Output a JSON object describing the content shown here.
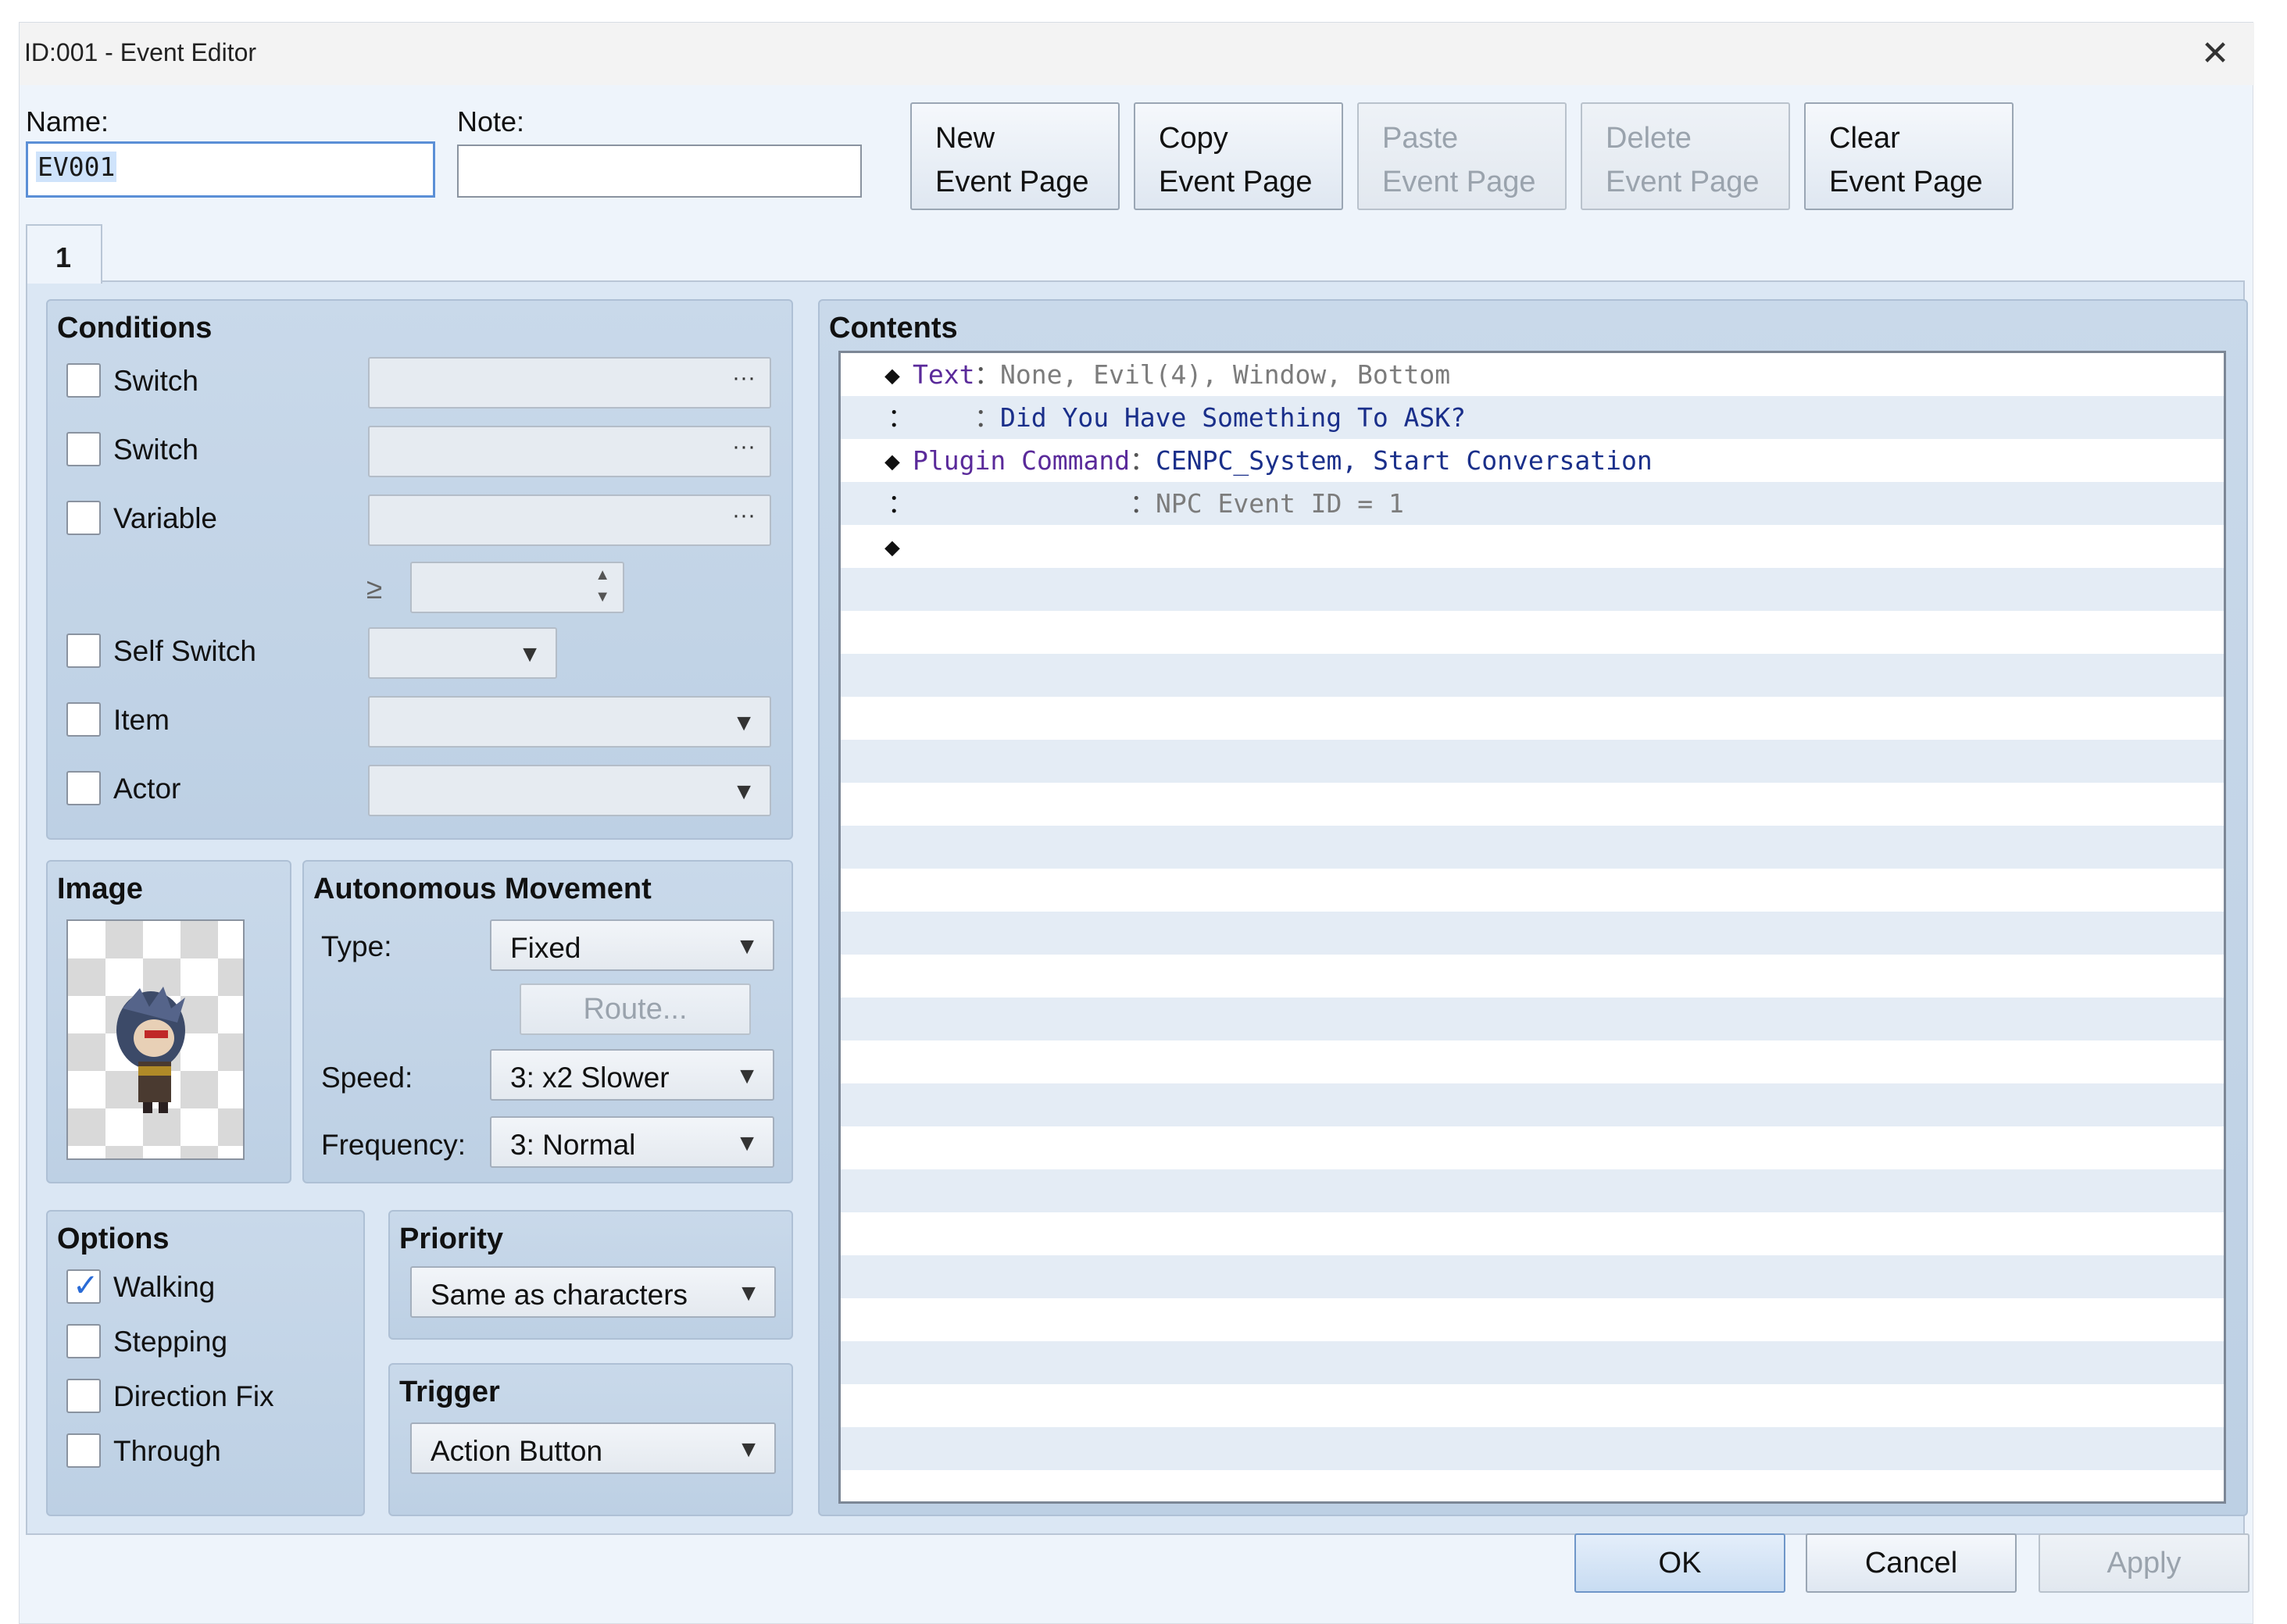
{
  "window": {
    "title": "ID:001 - Event Editor",
    "close_glyph": "✕"
  },
  "header": {
    "name_label": "Name:",
    "name_value": "EV001",
    "note_label": "Note:",
    "note_value": ""
  },
  "page_buttons": [
    {
      "line1": "New",
      "line2": "Event Page",
      "enabled": true
    },
    {
      "line1": "Copy",
      "line2": "Event Page",
      "enabled": true
    },
    {
      "line1": "Paste",
      "line2": "Event Page",
      "enabled": false
    },
    {
      "line1": "Delete",
      "line2": "Event Page",
      "enabled": false
    },
    {
      "line1": "Clear",
      "line2": "Event Page",
      "enabled": true
    }
  ],
  "tabs": [
    "1"
  ],
  "conditions": {
    "title": "Conditions",
    "switch1_label": "Switch",
    "switch2_label": "Switch",
    "variable_label": "Variable",
    "ge_symbol": "≥",
    "self_switch_label": "Self Switch",
    "item_label": "Item",
    "actor_label": "Actor",
    "dots": "···",
    "arrow": "▼"
  },
  "image": {
    "title": "Image",
    "sprite_icon": "character-sprite"
  },
  "movement": {
    "title": "Autonomous Movement",
    "type_label": "Type:",
    "type_value": "Fixed",
    "route_label": "Route...",
    "speed_label": "Speed:",
    "speed_value": "3: x2 Slower",
    "frequency_label": "Frequency:",
    "frequency_value": "3: Normal"
  },
  "options": {
    "title": "Options",
    "walking": "Walking",
    "walking_checked": true,
    "stepping": "Stepping",
    "direction_fix": "Direction Fix",
    "through": "Through",
    "tick": "✓"
  },
  "priority": {
    "title": "Priority",
    "value": "Same as characters"
  },
  "trigger": {
    "title": "Trigger",
    "value": "Action Button"
  },
  "contents": {
    "title": "Contents",
    "rows": [
      {
        "diamond": "◆",
        "cmd": "Text",
        "sep": "：",
        "args": "None, Evil(4), Window, Bottom"
      },
      {
        "lead": "：",
        "sep": "：",
        "args": "Did You Have Something To ASK?"
      },
      {
        "diamond": "◆",
        "cmd": "Plugin Command",
        "sep": "：",
        "args": "CENPC_System, Start Conversation"
      },
      {
        "lead": "：",
        "sep": "：",
        "args": "NPC Event ID = 1"
      },
      {
        "diamond": "◆"
      }
    ]
  },
  "footer": {
    "ok": "OK",
    "cancel": "Cancel",
    "apply": "Apply"
  }
}
